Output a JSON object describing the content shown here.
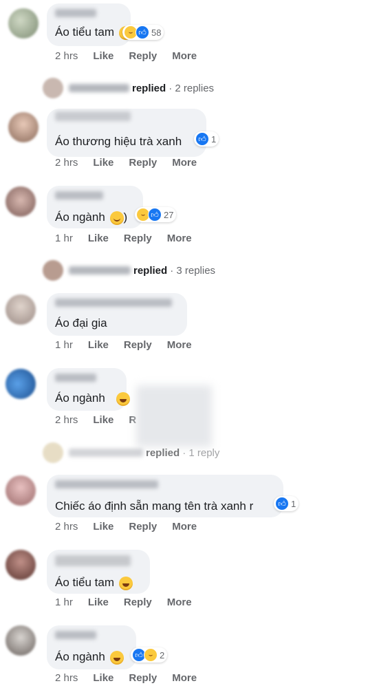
{
  "comments": [
    {
      "text": "Áo tiểu tam",
      "reaction_count": "58",
      "time": "2 hrs",
      "like": "Like",
      "reply": "Reply",
      "more": "More"
    },
    {
      "text": "Áo thương hiệu trà xanh",
      "reaction_count": "1",
      "time": "2 hrs",
      "like": "Like",
      "reply": "Reply",
      "more": "More"
    },
    {
      "text": "Áo ngành",
      "text_suffix": ")",
      "reaction_count": "27",
      "time": "1 hr",
      "like": "Like",
      "reply": "Reply",
      "more": "More"
    },
    {
      "text": "Áo đại gia",
      "time": "1 hr",
      "like": "Like",
      "reply": "Reply",
      "more": "More"
    },
    {
      "text": "Áo ngành",
      "time": "2 hrs",
      "like": "Like",
      "reply": "R"
    },
    {
      "text": "Chiếc áo định sẵn mang tên trà xanh r",
      "reaction_count": "1",
      "time": "2 hrs",
      "like": "Like",
      "reply": "Reply",
      "more": "More"
    },
    {
      "text": "Áo tiểu tam",
      "time": "1 hr",
      "like": "Like",
      "reply": "Reply",
      "more": "More"
    },
    {
      "text": "Áo ngành",
      "reaction_count": "2",
      "time": "2 hrs",
      "like": "Like",
      "reply": "Reply",
      "more": "More"
    }
  ],
  "reply_threads": [
    {
      "word": "replied",
      "count": "· 2 replies"
    },
    {
      "word": "replied",
      "count": "· 3 replies"
    },
    {
      "word": "replied",
      "count": "· 1 reply"
    }
  ],
  "icons": {
    "like": "thumbs-up-icon",
    "haha": "laughing-emoji-icon",
    "smile": "smile-emoji-icon"
  },
  "colors": {
    "bubble": "#f0f2f5",
    "like_blue": "#1877f2",
    "meta_gray": "#65676b"
  }
}
